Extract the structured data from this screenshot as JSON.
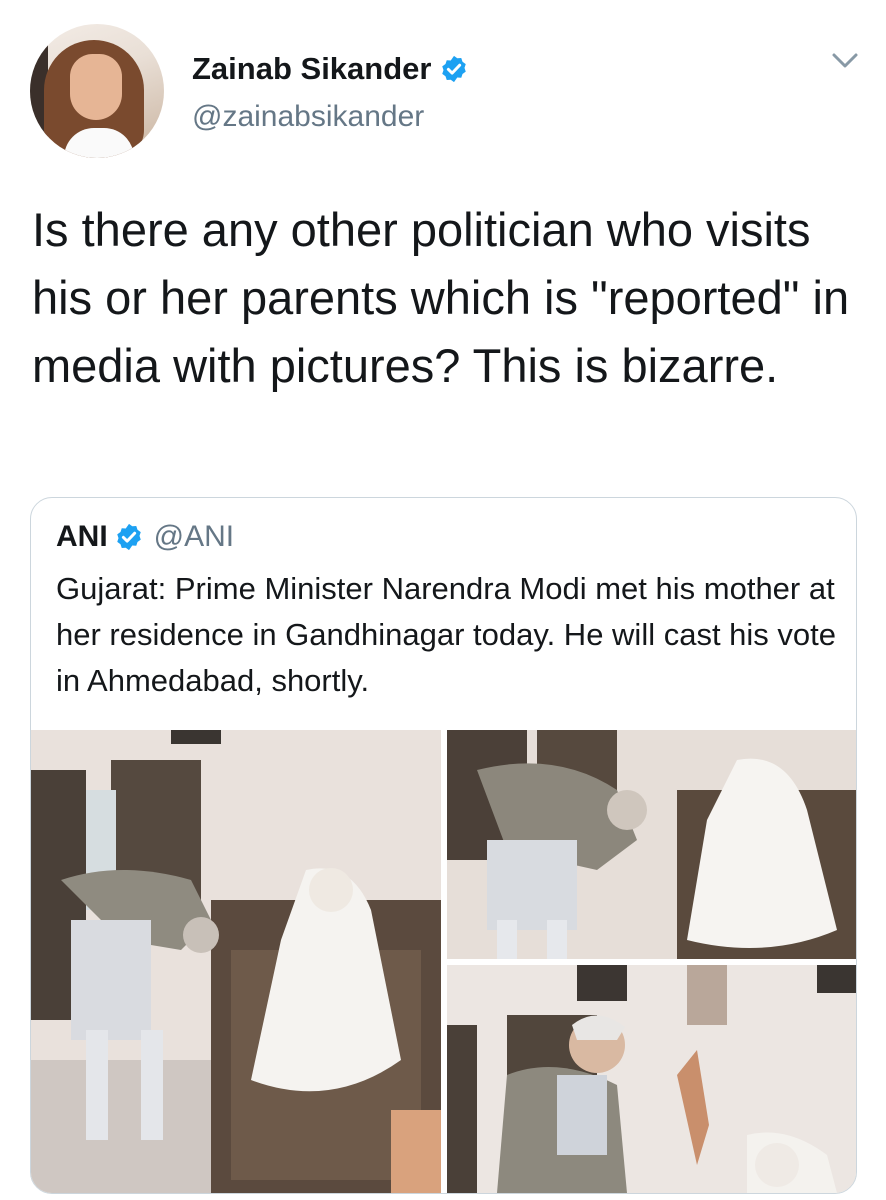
{
  "tweet": {
    "author": {
      "display_name": "Zainab Sikander",
      "handle": "@zainabsikander",
      "verified": true
    },
    "text": "Is there any other politician who visits his or her parents which is \"reported\" in media with pictures? This is bizarre.",
    "menu_icon": "chevron-down-icon"
  },
  "quoted_tweet": {
    "display_name": "ANI",
    "handle": "@ANI",
    "verified": true,
    "text": "Gujarat: Prime Minister Narendra Modi met his mother at her residence in Gandhinagar today. He will cast his vote in Ahmedabad, shortly.",
    "media_count": 3
  },
  "colors": {
    "verified_blue": "#1da1f2",
    "secondary_text": "#657786",
    "card_border": "#ccd6dd"
  }
}
